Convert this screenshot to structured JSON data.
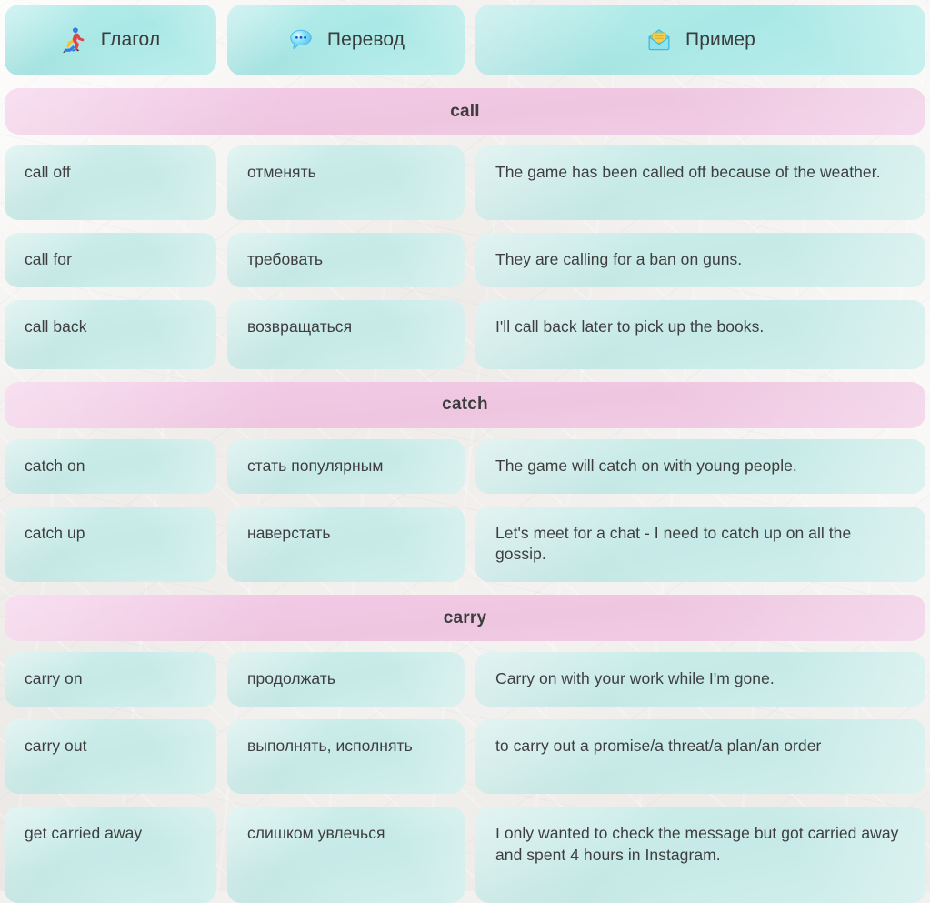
{
  "header": {
    "columns": [
      {
        "label": "Глагол",
        "icon": "running-person-icon"
      },
      {
        "label": "Перевод",
        "icon": "speech-bubble-icon"
      },
      {
        "label": "Пример",
        "icon": "open-envelope-icon"
      }
    ]
  },
  "colors": {
    "header_card": "#b0eae7",
    "cell": "#cdeeeb",
    "section_band": "#f1cae6",
    "text": "#3e3e40",
    "paper": "#f3f1ef"
  },
  "sections": [
    {
      "title": "call",
      "rows": [
        {
          "verb": "call off",
          "translation": "отменять",
          "example": "The game has been called off because of the weather."
        },
        {
          "verb": "call for",
          "translation": "требовать",
          "example": "They are calling for a ban on guns."
        },
        {
          "verb": "call back",
          "translation": "возвращаться",
          "example": "I'll call back later to pick up the books."
        }
      ]
    },
    {
      "title": "catch",
      "rows": [
        {
          "verb": "catch on",
          "translation": "стать популярным",
          "example": "The game will catch on with young people."
        },
        {
          "verb": "catch up",
          "translation": "наверстать",
          "example": "Let's meet for a chat - I need to catch up on all the gossip."
        }
      ]
    },
    {
      "title": "carry",
      "rows": [
        {
          "verb": "carry on",
          "translation": "продолжать",
          "example": "Carry on with your work while I'm gone."
        },
        {
          "verb": "carry out",
          "translation": "выполнять, исполнять",
          "example": "to carry out a promise/a threat/a plan/an order"
        },
        {
          "verb": "get carried away",
          "translation": "слишком увлечься",
          "example": "I only wanted to check the message but got carried away and spent 4 hours in Instagram."
        }
      ]
    }
  ]
}
